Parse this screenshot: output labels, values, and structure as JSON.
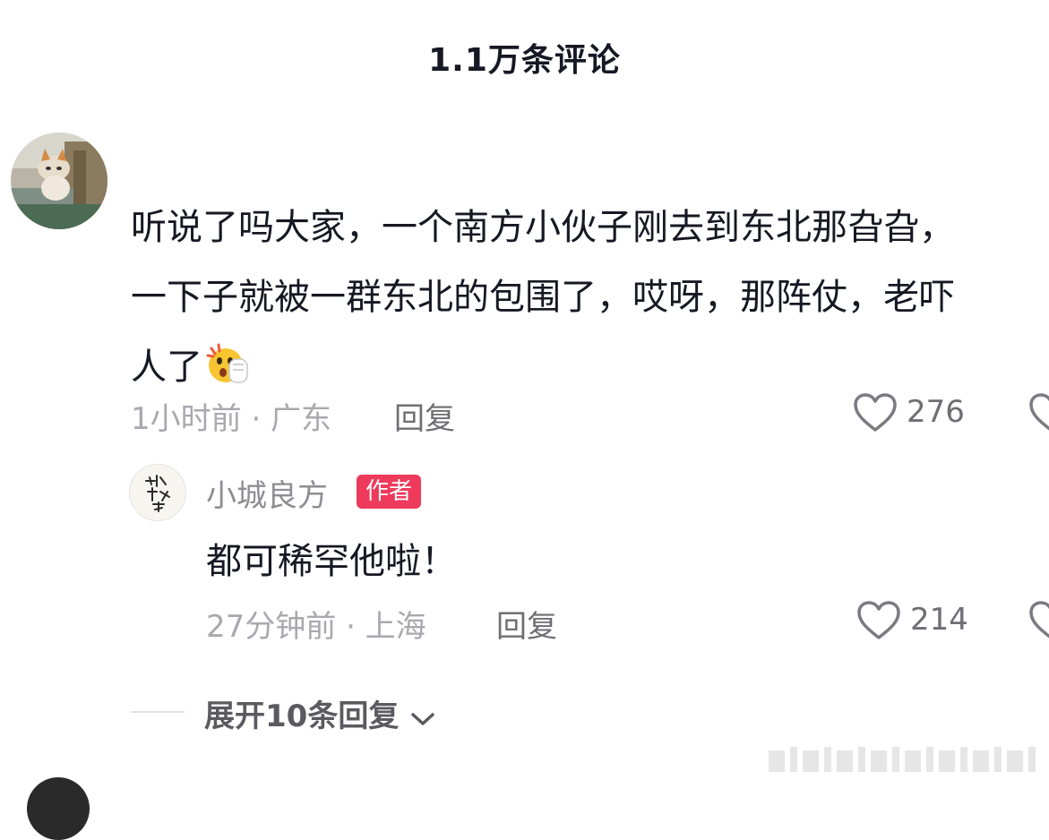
{
  "header": {
    "title": "1.1万条评论"
  },
  "comment": {
    "avatar_icon": "cat-avatar",
    "text": "听说了吗大家，一个南方小伙子刚去到东北那旮旮，\n一下子就被一群东北的包围了，哎呀，那阵仗，老吓\n人了",
    "emoji_icon": "shocked-face-emoji",
    "time_location": "1小时前 · 广东",
    "reply_label": "回复",
    "like_count": "276"
  },
  "reply": {
    "author": "小城良方",
    "badge": "作者",
    "text": "都可稀罕他啦！",
    "time_location": "27分钟前 · 上海",
    "reply_label": "回复",
    "like_count": "214"
  },
  "expand": {
    "label": "展开10条回复"
  },
  "colors": {
    "badge": "#ee3a5b",
    "text_primary": "#161823",
    "text_meta": "#a8a8ae"
  }
}
